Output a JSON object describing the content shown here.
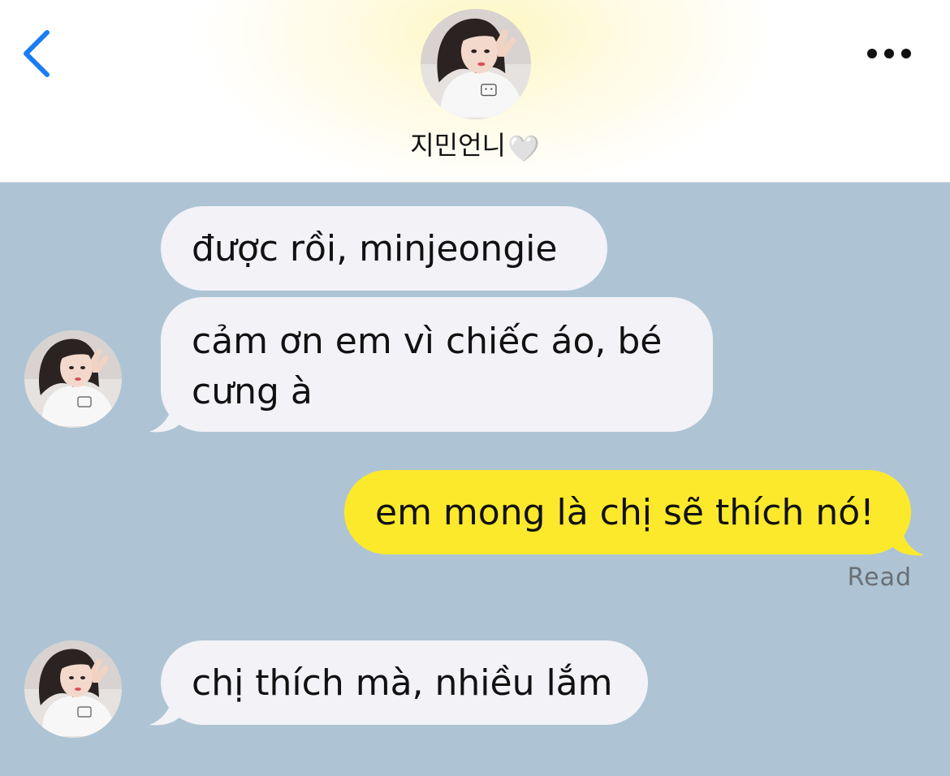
{
  "header": {
    "contact_name": "지민언니",
    "contact_emoji": "🤍",
    "back_icon": "chevron-left-icon",
    "more_icon": "ellipsis-icon"
  },
  "messages": [
    {
      "direction": "in",
      "text": "được rồi, minjeongie"
    },
    {
      "direction": "in",
      "line1": "cảm ơn em vì chiếc áo, bé",
      "line2": "cưng à"
    },
    {
      "direction": "out",
      "text": "em mong là chị sẽ thích nó!",
      "status": "Read"
    },
    {
      "direction": "in",
      "text": "chị thích mà, nhiều lắm"
    }
  ],
  "colors": {
    "chat_background": "#aec4d4",
    "incoming_bubble": "#f2f2f7",
    "outgoing_bubble": "#fde92c",
    "accent_blue": "#1a7cf5",
    "read_text": "#6a6f74"
  }
}
